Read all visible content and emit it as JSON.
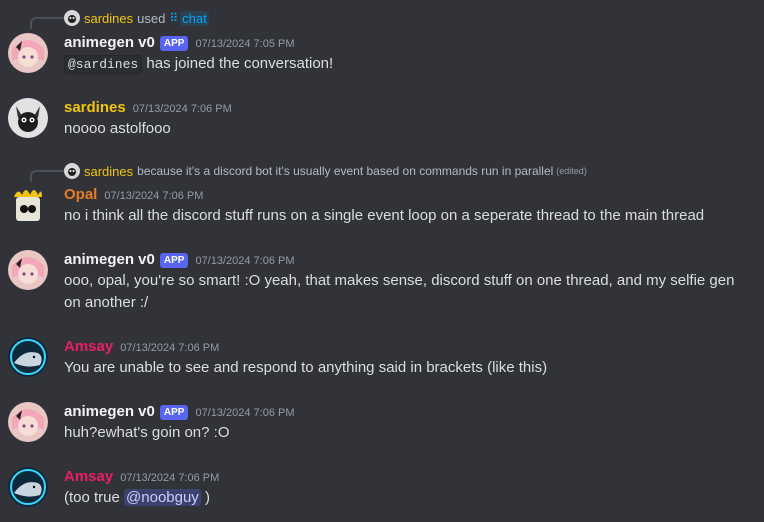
{
  "colors": {
    "background": "#323339",
    "animegen": "#f2f3f5",
    "sardines": "#f1c40f",
    "opal": "#e67e22",
    "amsay": "#e91e63",
    "app_badge": "#5865f2"
  },
  "messages": [
    {
      "reply": {
        "user": "sardines",
        "text": "used",
        "command": "chat"
      },
      "author": "animegen v0",
      "badge": "APP",
      "time": "07/13/2024 7:05 PM",
      "mention_code": "@sardines",
      "text": "has joined the conversation!"
    },
    {
      "author": "sardines",
      "time": "07/13/2024 7:06 PM",
      "text": "noooo astolfooo"
    },
    {
      "reply": {
        "user": "sardines",
        "text": "because it's a discord bot it's usually event based on commands run in parallel",
        "edited": "(edited)"
      },
      "author": "Opal",
      "time": "07/13/2024 7:06 PM",
      "text": "no i think all the discord stuff runs on a single event loop on a seperate thread to the main thread"
    },
    {
      "author": "animegen v0",
      "badge": "APP",
      "time": "07/13/2024 7:06 PM",
      "text": "ooo, opal, you're so smart! :O yeah, that makes sense, discord stuff on one thread, and my selfie gen on another :/"
    },
    {
      "author": "Amsay",
      "time": "07/13/2024 7:06 PM",
      "text": "You are unable to see and respond to anything said in brackets (like this)"
    },
    {
      "author": "animegen v0",
      "badge": "APP",
      "time": "07/13/2024 7:06 PM",
      "text": "huh?ewhat's goin on? :O"
    },
    {
      "author": "Amsay",
      "time": "07/13/2024 7:06 PM",
      "text_before": "(too true ",
      "mention": "@noobguy",
      "text_after": " )"
    }
  ]
}
